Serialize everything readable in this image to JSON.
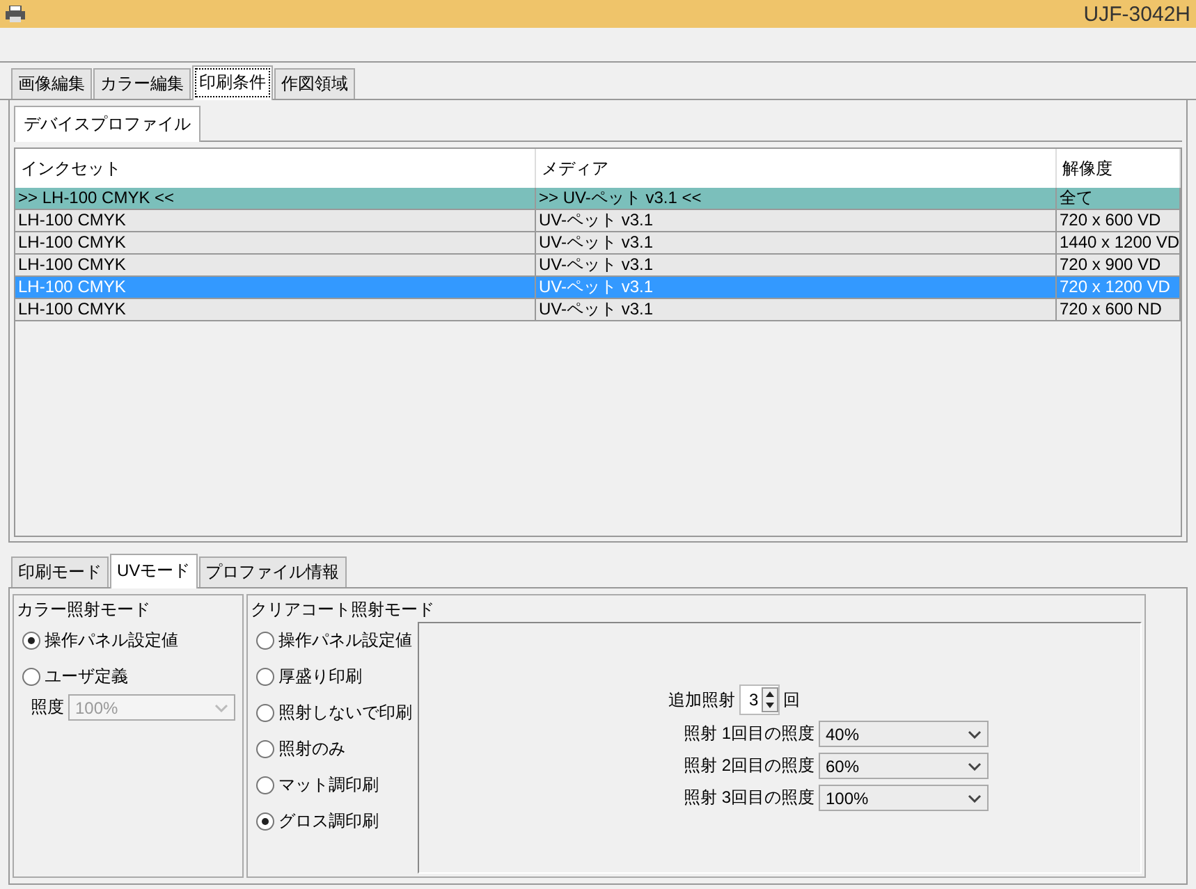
{
  "window": {
    "title": "UJF-3042H"
  },
  "main_tabs": [
    {
      "label": "画像編集",
      "selected": false
    },
    {
      "label": "カラー編集",
      "selected": false
    },
    {
      "label": "印刷条件",
      "selected": true
    },
    {
      "label": "作図領域",
      "selected": false
    }
  ],
  "profile_tabs": [
    {
      "label": "デバイスプロファイル",
      "selected": true
    }
  ],
  "table": {
    "columns": [
      "インクセット",
      "メディア",
      "解像度"
    ],
    "rows": [
      {
        "kind": "filter",
        "selected": false,
        "cells": [
          ">> LH-100 CMYK <<",
          ">> UV-ペット v3.1 <<",
          "全て"
        ]
      },
      {
        "kind": "item",
        "selected": false,
        "cells": [
          "LH-100 CMYK",
          "UV-ペット v3.1",
          "720 x 600 VD"
        ]
      },
      {
        "kind": "item",
        "selected": false,
        "cells": [
          "LH-100 CMYK",
          "UV-ペット v3.1",
          "1440 x 1200 VD"
        ]
      },
      {
        "kind": "item",
        "selected": false,
        "cells": [
          "LH-100 CMYK",
          "UV-ペット v3.1",
          "720 x 900 VD"
        ]
      },
      {
        "kind": "item",
        "selected": true,
        "cells": [
          "LH-100 CMYK",
          "UV-ペット v3.1",
          "720 x 1200 VD"
        ]
      },
      {
        "kind": "item",
        "selected": false,
        "cells": [
          "LH-100 CMYK",
          "UV-ペット v3.1",
          "720 x 600 ND"
        ]
      }
    ]
  },
  "bottom_tabs": [
    {
      "label": "印刷モード",
      "selected": false
    },
    {
      "label": "UVモード",
      "selected": true
    },
    {
      "label": "プロファイル情報",
      "selected": false
    }
  ],
  "color_mode": {
    "title": "カラー照射モード",
    "options": [
      {
        "label": "操作パネル設定値",
        "selected": true
      },
      {
        "label": "ユーザ定義",
        "selected": false
      }
    ],
    "intensity": {
      "label": "照度",
      "value": "100%",
      "disabled": true
    }
  },
  "clearcoat_mode": {
    "title": "クリアコート照射モード",
    "options": [
      {
        "label": "操作パネル設定値",
        "selected": false
      },
      {
        "label": "厚盛り印刷",
        "selected": false
      },
      {
        "label": "照射しないで印刷",
        "selected": false
      },
      {
        "label": "照射のみ",
        "selected": false
      },
      {
        "label": "マット調印刷",
        "selected": false
      },
      {
        "label": "グロス調印刷",
        "selected": true
      }
    ],
    "additional": {
      "label": "追加照射",
      "value": "3",
      "unit": "回"
    },
    "passes": [
      {
        "label": "照射 1回目の照度",
        "value": "40%"
      },
      {
        "label": "照射 2回目の照度",
        "value": "60%"
      },
      {
        "label": "照射 3回目の照度",
        "value": "100%"
      }
    ]
  }
}
